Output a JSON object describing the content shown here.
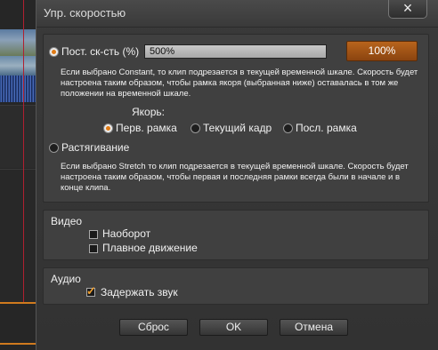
{
  "window": {
    "title": "Упр. скоростью",
    "close_icon": "×"
  },
  "speed": {
    "constant_label": "Пост. ск-сть (%)",
    "constant_value": "500%",
    "percent_button": "100%",
    "constant_desc": "Если выбрано Constant, то клип подрезается в текущей временной шкале. Скорость будет настроена таким образом, чтобы рамка якоря (выбранная ниже) оставалась в том же положении на временной шкале.",
    "anchor_label": "Якорь:",
    "anchor_options": [
      "Перв. рамка",
      "Текущий кадр",
      "Посл. рамка"
    ],
    "stretch_label": "Растягивание",
    "stretch_desc": "Если выбрано Stretch то клип подрезается в текущей временной шкале. Скорость будет настроена таким образом, чтобы первая и последняя рамки всегда были в начале и в конце клипа."
  },
  "video": {
    "title": "Видео",
    "reverse_label": "Наоборот",
    "smooth_label": "Плавное движение"
  },
  "audio": {
    "title": "Аудио",
    "hold_label": "Задержать звук"
  },
  "buttons": {
    "reset": "Сброс",
    "ok": "OK",
    "cancel": "Отмена"
  },
  "colors": {
    "accent": "#e07a14",
    "timeline_marker": "#b02030"
  }
}
